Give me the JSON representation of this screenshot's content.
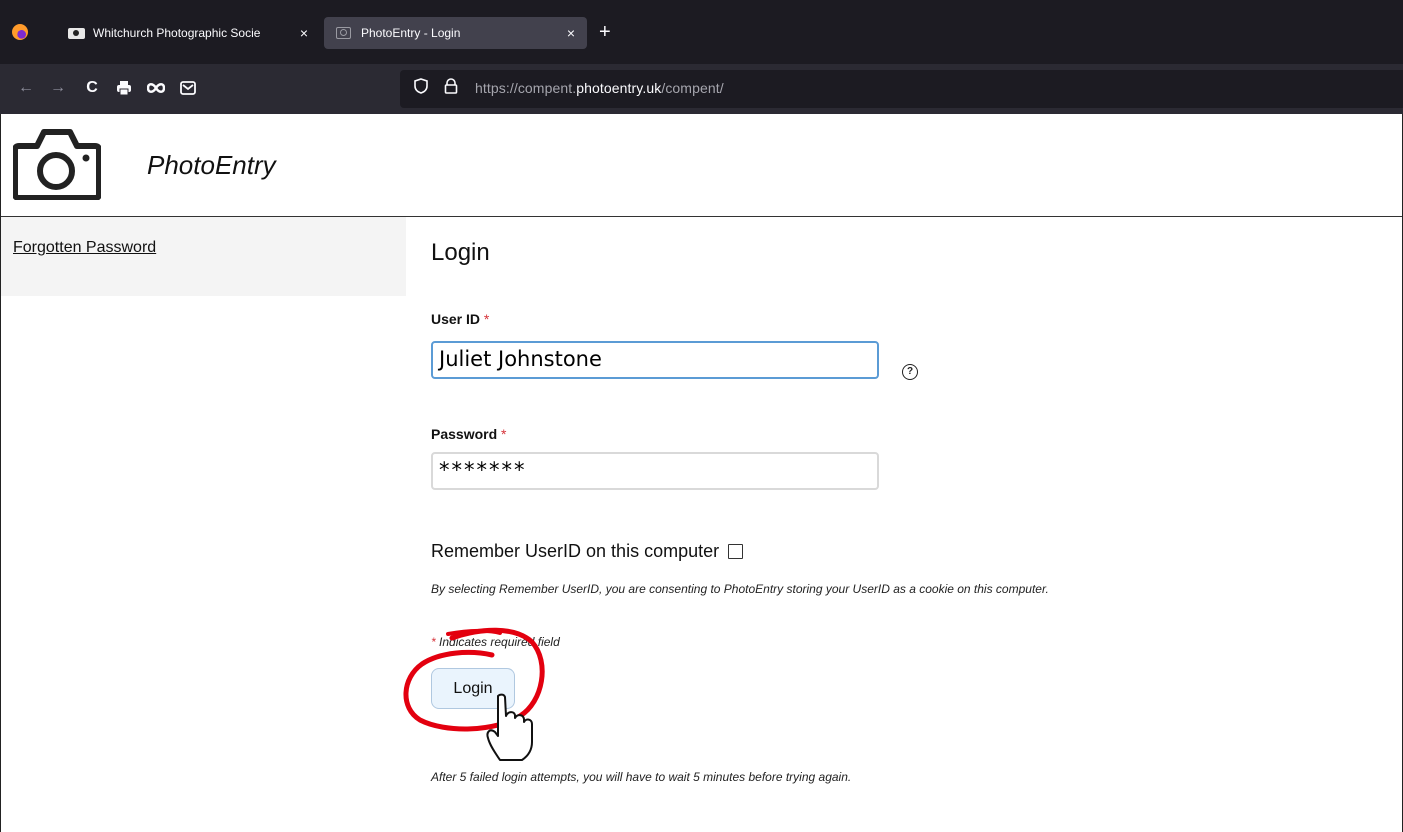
{
  "browser": {
    "tabs": [
      {
        "title": "Whitchurch Photographic Socie",
        "close": "×"
      },
      {
        "title": "PhotoEntry - Login",
        "close": "×"
      }
    ],
    "new_tab": "+",
    "nav": {
      "back": "←",
      "forward": "→",
      "reload": "C"
    },
    "url": {
      "prefix": "https://compent.",
      "domain": "photoentry.uk",
      "path": "/compent/"
    }
  },
  "header": {
    "site_name": "PhotoEntry"
  },
  "sidebar": {
    "forgotten_password": "Forgotten Password"
  },
  "main": {
    "title": "Login",
    "user_id": {
      "label": "User ID",
      "required_mark": "*",
      "value": "Juliet Johnstone",
      "help": "?"
    },
    "password": {
      "label": "Password",
      "required_mark": "*",
      "value": "*******"
    },
    "remember_label": "Remember UserID on this computer",
    "consent_text": "By selecting Remember UserID, you are consenting to PhotoEntry storing your UserID as a cookie on this computer.",
    "required_note": {
      "mark": "*",
      "text": " Indicates required field"
    },
    "login_button": "Login",
    "attempts_text": "After 5 failed login attempts, you will have to wait 5 minutes before trying again."
  },
  "colors": {
    "tab_bar": "#1c1b22",
    "nav_bar": "#2b2a33",
    "required": "#d6333a",
    "annotation": "#e3000f",
    "login_button_bg": "#eaf4fd"
  }
}
